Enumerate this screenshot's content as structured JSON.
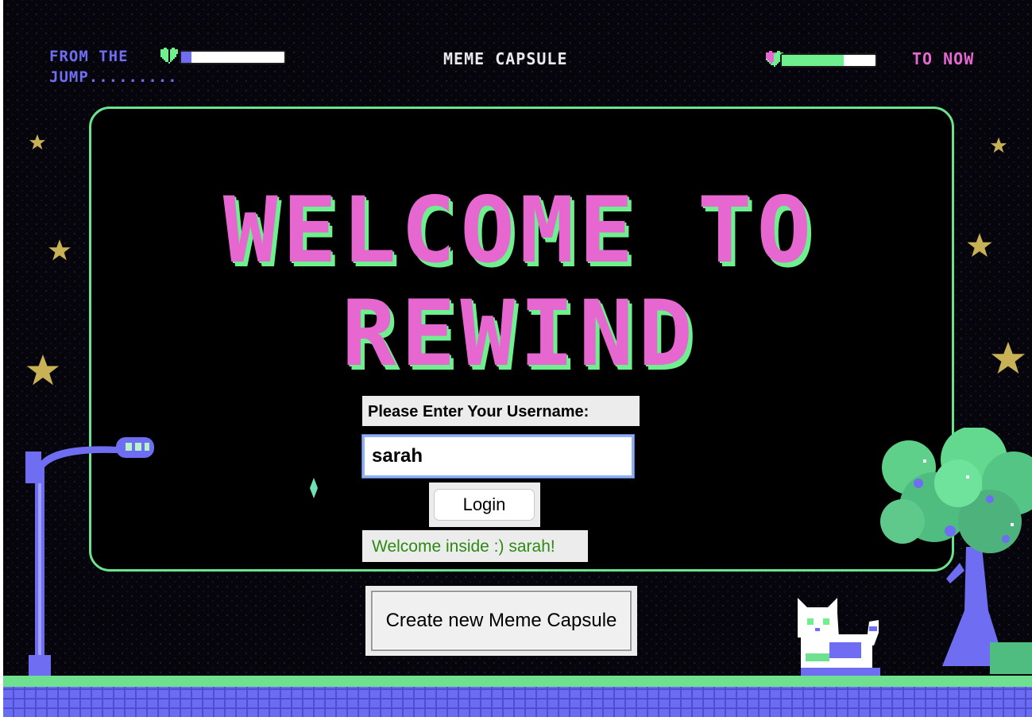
{
  "header": {
    "left_text": "FROM THE JUMP.........",
    "title": "MEME CAPSULE",
    "right_text": "TO NOW"
  },
  "hero": {
    "line1": "WELCOME TO",
    "line2": "REWIND"
  },
  "login_form": {
    "label": "Please Enter Your Username:",
    "username_value": "sarah",
    "login_button": "Login",
    "status_message": "Welcome inside :) sarah!"
  },
  "actions": {
    "create_capsule_button": "Create new Meme Capsule"
  },
  "progress": {
    "left_bar_fill": 0.1,
    "right_bar_fill": 0.66
  },
  "colors": {
    "pink": "#e567cf",
    "green": "#6ef08f",
    "purple": "#6f6ef2",
    "star": "#c9b155",
    "status_green": "#2d8a12"
  },
  "icons": [
    "heart-icon",
    "star-icon",
    "street-lamp",
    "pixel-tree",
    "pixel-cat",
    "sparkle-icon"
  ]
}
